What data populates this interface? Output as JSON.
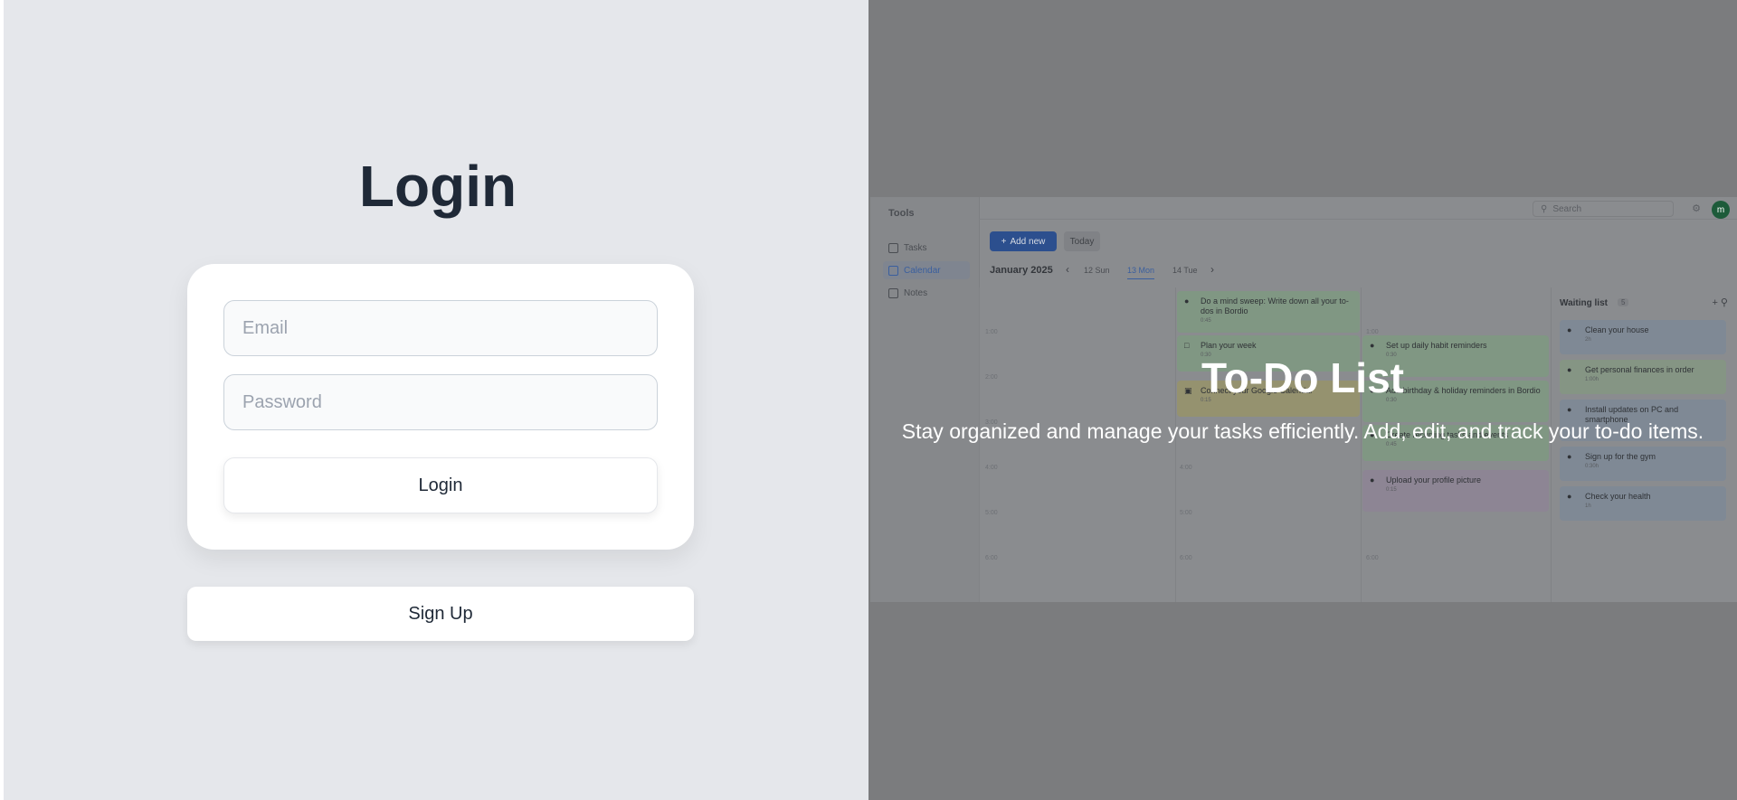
{
  "login": {
    "title": "Login",
    "email_placeholder": "Email",
    "password_placeholder": "Password",
    "login_button": "Login",
    "signup_button": "Sign Up"
  },
  "hero": {
    "title": "To-Do List",
    "subtitle": "Stay organized and manage your tasks efficiently. Add, edit, and track your to-do items."
  },
  "preview": {
    "sidebar_title": "Tools",
    "nav": [
      "Tasks",
      "Calendar",
      "Notes"
    ],
    "active_nav": "Calendar",
    "search_placeholder": "Search",
    "avatar_letter": "m",
    "add_new": "Add new",
    "today": "Today",
    "month": "January 2025",
    "days": [
      "12 Sun",
      "13 Mon",
      "14 Tue"
    ],
    "active_day": "13 Mon",
    "times": [
      "1:00",
      "2:00",
      "3:00",
      "4:00",
      "5:00",
      "6:00"
    ],
    "tasks": [
      {
        "title": "Do a mind sweep: Write down all your to-dos in Bordio",
        "dur": "0:45"
      },
      {
        "title": "Plan your week",
        "dur": "0:30"
      },
      {
        "title": "Connect your Google Calendar",
        "dur": "0:15"
      },
      {
        "title": "Set up daily habit reminders",
        "dur": "0:30"
      },
      {
        "title": "Add birthday & holiday reminders in Bordio",
        "dur": "0:30"
      },
      {
        "title": "Create recurring tasks and events",
        "dur": "0:45"
      },
      {
        "title": "Upload your profile picture",
        "dur": "0:15"
      }
    ],
    "waiting_title": "Waiting list",
    "waiting_count": "5",
    "waiting": [
      {
        "title": "Clean your house",
        "dur": "2h"
      },
      {
        "title": "Get personal finances in order",
        "dur": "1:00h"
      },
      {
        "title": "Install updates on PC and smartphone",
        "dur": ""
      },
      {
        "title": "Sign up for the gym",
        "dur": "0:30h"
      },
      {
        "title": "Check your health",
        "dur": "1h"
      }
    ]
  }
}
